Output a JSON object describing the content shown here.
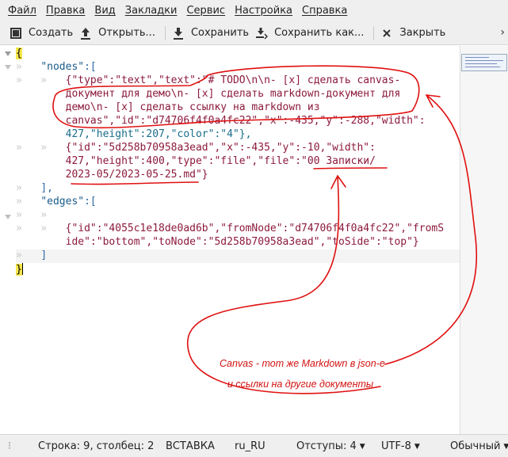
{
  "menubar": {
    "items": [
      "Файл",
      "Правка",
      "Вид",
      "Закладки",
      "Сервис",
      "Настройка",
      "Справка"
    ]
  },
  "toolbar": {
    "create": "Создать",
    "open": "Открыть...",
    "save": "Сохранить",
    "save_as": "Сохранить как...",
    "close": "Закрыть"
  },
  "editor": {
    "lines": {
      "l1": "{",
      "l2_key": "\"nodes\"",
      "l3a": "{\"type\":\"text\",\"text\":\"# TODO\\n\\n- [x] сделать canvas-",
      "l3b": "документ для демо\\n- [x] сделать markdown-документ для",
      "l3c": "демо\\n- [x] сделать ссылку на markdown из",
      "l3d": "canvas\",\"id\":\"d74706f4f0a4fc22\",\"x\":-435,\"y\":-288,\"width\":",
      "l3e": "427,\"height\":207,\"color\":\"4\"},",
      "l4a": "{\"id\":\"5d258b70958a3ead\",\"x\":-435,\"y\":-10,\"width\":",
      "l4b": "427,\"height\":400,\"type\":\"file\",\"file\":\"00 Записки/",
      "l4c": "2023-05/2023-05-25.md\"}",
      "l5": "],",
      "l6_key": "\"edges\"",
      "l8a": "{\"id\":\"4055c1e18de0ad6b\",\"fromNode\":\"d74706f4f0a4fc22\",\"fromS",
      "l8b": "ide\":\"bottom\",\"toNode\":\"5d258b70958a3ead\",\"toSide\":\"top\"}",
      "l9": "]",
      "l10": "}"
    }
  },
  "annotation": {
    "line1": "Canvas - тот же Markdown в json-е",
    "line2": "и ссылки на другие документы",
    "color": "#d21111"
  },
  "statusbar": {
    "position": "Строка: 9, столбец: 2",
    "mode": "ВСТАВКА",
    "lang": "ru_RU",
    "indent": "Отступы: 4",
    "encoding": "UTF-8",
    "style": "Обычный"
  }
}
